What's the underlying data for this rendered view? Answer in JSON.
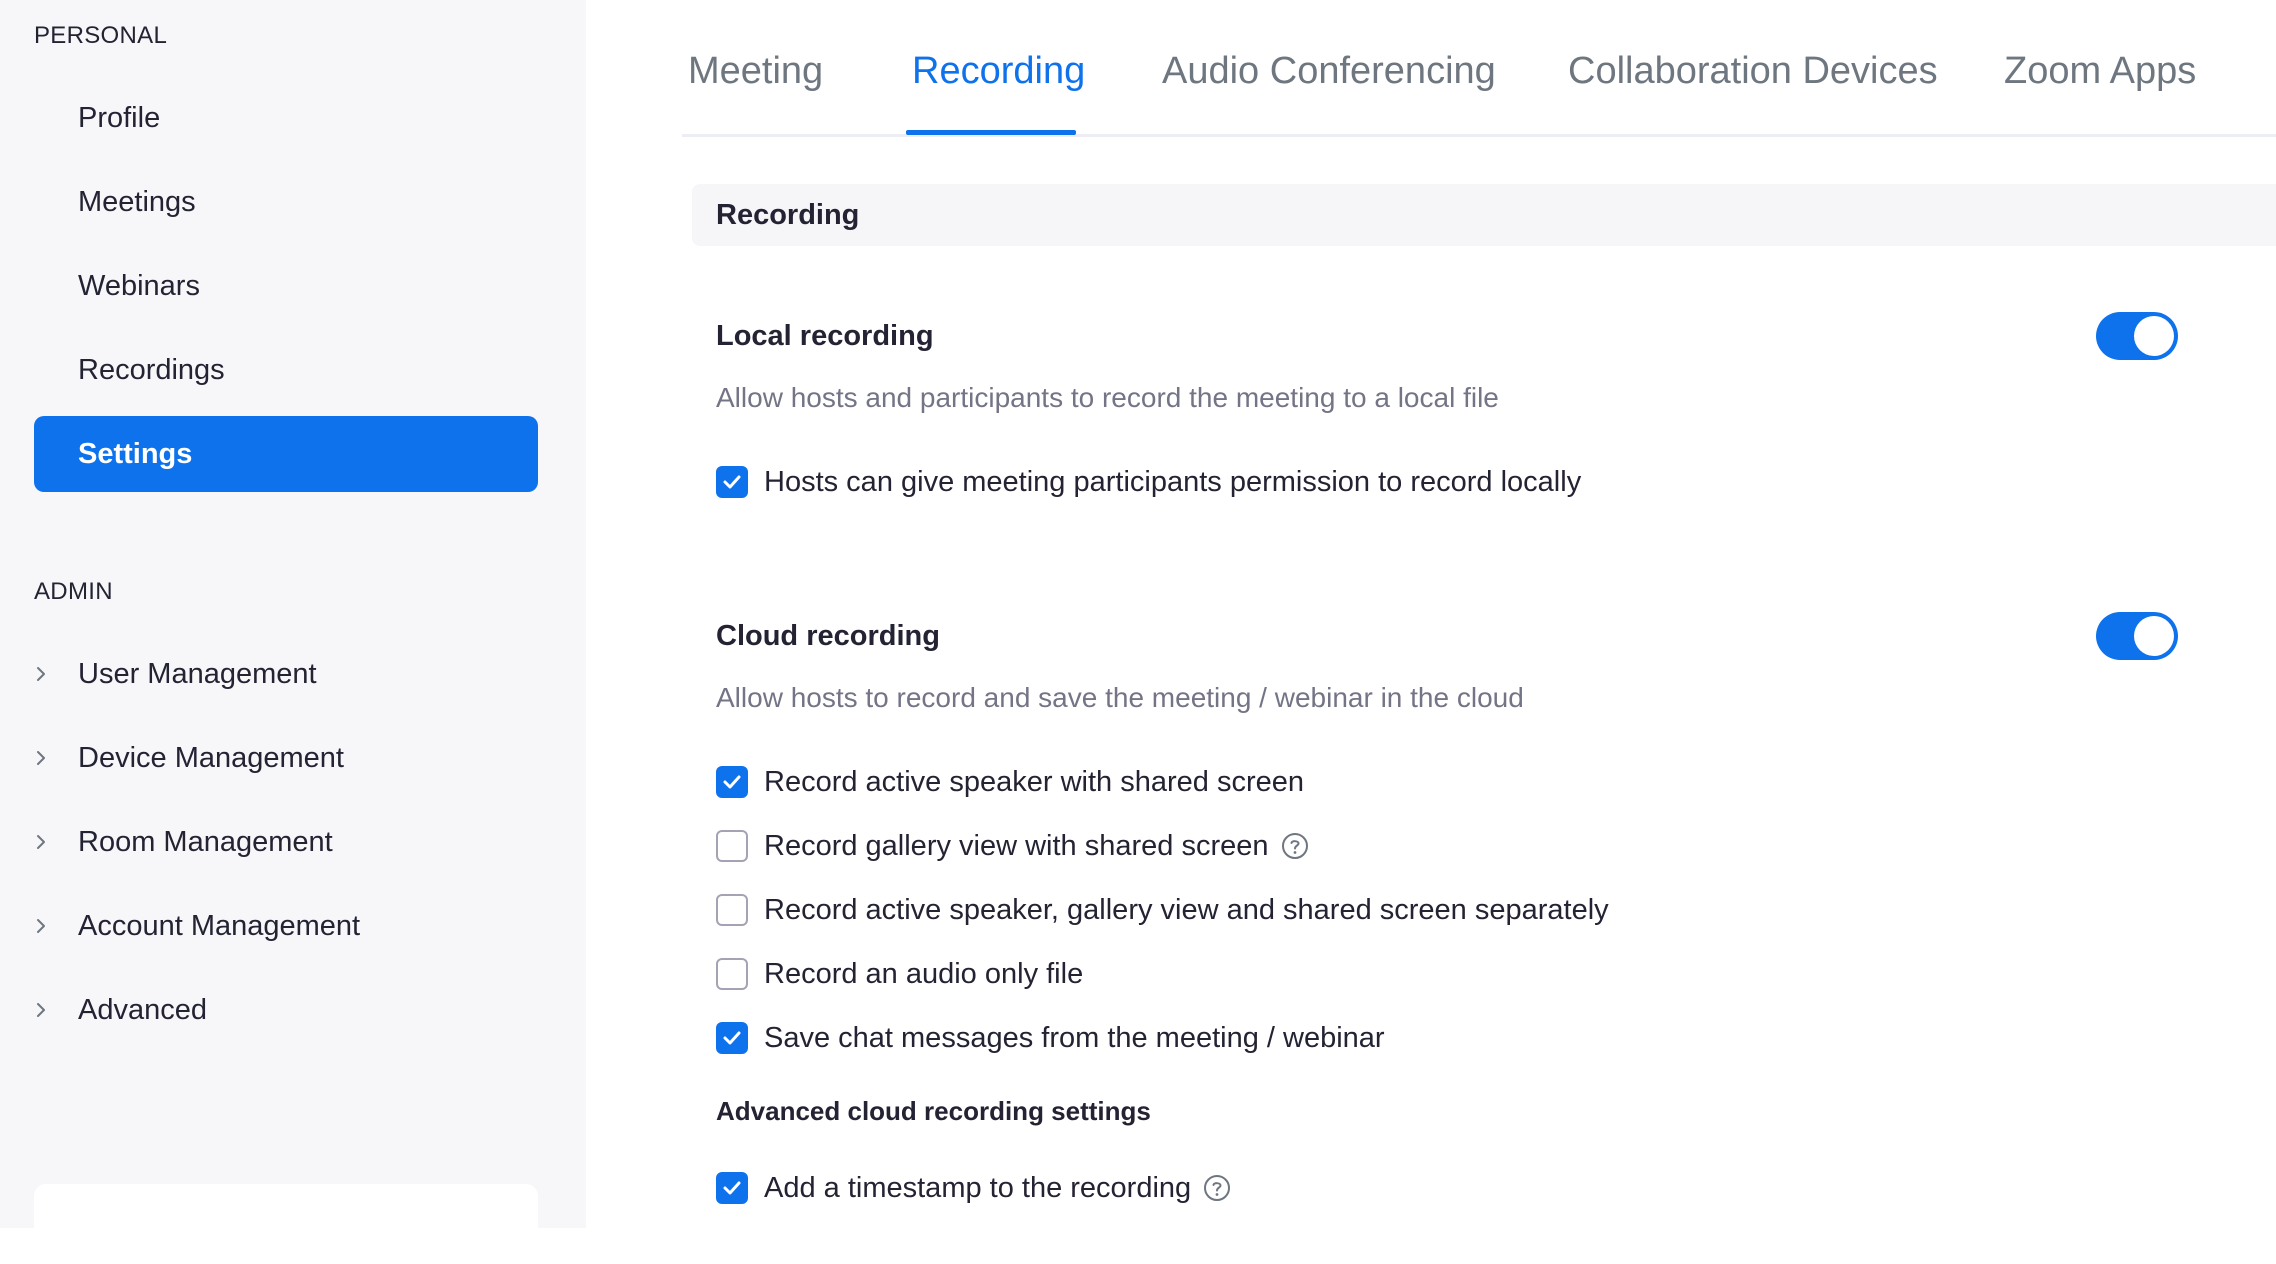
{
  "sidebar": {
    "personal_label": "PERSONAL",
    "personal_items": [
      {
        "label": "Profile"
      },
      {
        "label": "Meetings"
      },
      {
        "label": "Webinars"
      },
      {
        "label": "Recordings"
      },
      {
        "label": "Settings",
        "active": true
      }
    ],
    "admin_label": "ADMIN",
    "admin_items": [
      {
        "label": "User Management"
      },
      {
        "label": "Device Management"
      },
      {
        "label": "Room Management"
      },
      {
        "label": "Account Management"
      },
      {
        "label": "Advanced"
      }
    ]
  },
  "tabs": [
    {
      "label": "Meeting"
    },
    {
      "label": "Recording",
      "active": true
    },
    {
      "label": "Audio Conferencing"
    },
    {
      "label": "Collaboration Devices"
    },
    {
      "label": "Zoom Apps"
    }
  ],
  "main": {
    "section_title": "Recording",
    "local_recording": {
      "title": "Local recording",
      "description": "Allow hosts and participants to record the meeting to a local file",
      "enabled": true,
      "options": [
        {
          "label": "Hosts can give meeting participants permission to record locally",
          "checked": true
        }
      ]
    },
    "cloud_recording": {
      "title": "Cloud recording",
      "description": "Allow hosts to record and save the meeting / webinar in the cloud",
      "enabled": true,
      "options": [
        {
          "label": "Record active speaker with shared screen",
          "checked": true
        },
        {
          "label": "Record gallery view with shared screen",
          "checked": false,
          "help": true
        },
        {
          "label": "Record active speaker, gallery view and shared screen separately",
          "checked": false
        },
        {
          "label": "Record an audio only file",
          "checked": false
        },
        {
          "label": "Save chat messages from the meeting / webinar",
          "checked": true
        }
      ],
      "advanced_title": "Advanced cloud recording settings",
      "advanced_options": [
        {
          "label": "Add a timestamp to the recording",
          "checked": true,
          "help": true
        }
      ]
    }
  },
  "colors": {
    "accent": "#0e72ed",
    "sidebar_bg": "#f7f7fa",
    "muted_text": "#747487",
    "tab_inactive": "#6e7680"
  },
  "icons": {
    "chevron": "chevron-right-icon",
    "check": "checkmark-icon",
    "help": "question-circle-icon"
  }
}
